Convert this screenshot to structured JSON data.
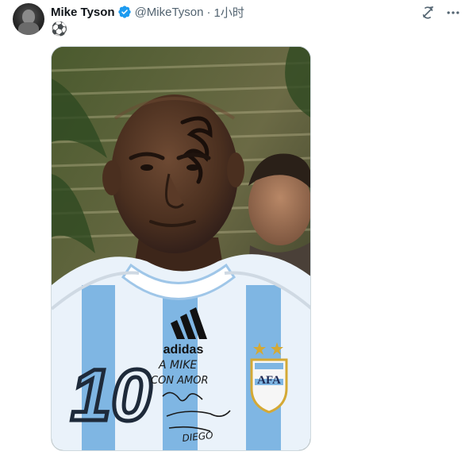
{
  "author": {
    "display_name": "Mike Tyson",
    "handle": "@MikeTyson",
    "separator": "·",
    "timestamp": "1小时",
    "verified": true
  },
  "tweet": {
    "text": "⚽"
  },
  "media": {
    "jersey_brand": "adidas",
    "jersey_number": "10",
    "autograph_lines": [
      "A MIKE",
      "CON AMOR"
    ],
    "crest_text": "AFA",
    "signature": "DIEGO"
  },
  "icons": {
    "verified": "verified-badge-icon",
    "grok": "grok-icon",
    "more": "more-icon"
  },
  "colors": {
    "verified_blue": "#1d9bf0",
    "text_primary": "#0f1419",
    "text_secondary": "#536471",
    "jersey_sky": "#7fb6e3"
  }
}
